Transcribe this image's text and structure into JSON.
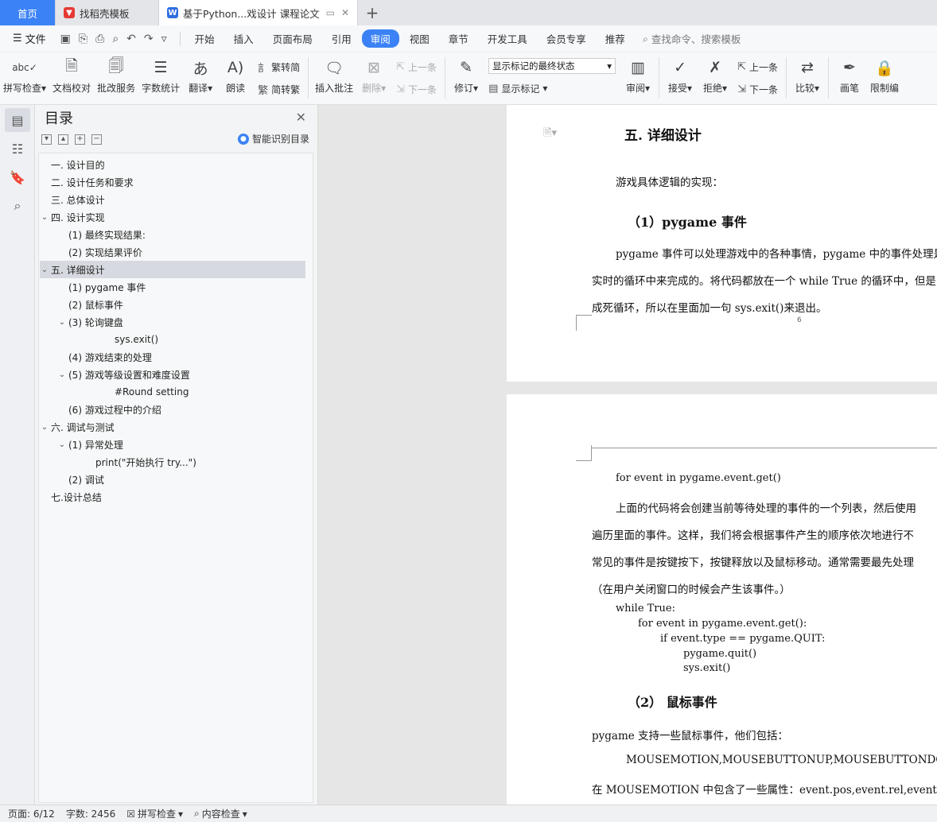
{
  "tabs": {
    "home": "首页",
    "template": "找稻壳模板",
    "doc": "基于Python...戏设计 课程论文"
  },
  "menu": {
    "file": "文件",
    "items": [
      "开始",
      "插入",
      "页面布局",
      "引用",
      "审阅",
      "视图",
      "章节",
      "开发工具",
      "会员专享",
      "推荐"
    ],
    "active": "审阅",
    "search": "查找命令、搜索模板"
  },
  "ribbon": {
    "spell": "拼写检查",
    "proof": "文档校对",
    "batch": "批改服务",
    "wordcount": "字数统计",
    "translate": "翻译",
    "read": "朗读",
    "to_simplified": "繁转简",
    "to_traditional": "简转繁",
    "insert_comment": "插入批注",
    "delete": "删除",
    "prev": "上一条",
    "next": "下一条",
    "revise": "修订",
    "markup_select": "显示标记的最终状态",
    "show_markup": "显示标记",
    "review": "审阅",
    "accept": "接受",
    "reject": "拒绝",
    "prev2": "上一条",
    "next2": "下一条",
    "compare": "比较",
    "pen": "画笔",
    "restrict": "限制编"
  },
  "toc": {
    "title": "目录",
    "smart": "智能识别目录",
    "items": [
      {
        "label": "一. 设计目的",
        "level": 1,
        "arrow": ""
      },
      {
        "label": "二. 设计任务和要求",
        "level": 1,
        "arrow": ""
      },
      {
        "label": "三. 总体设计",
        "level": 1,
        "arrow": ""
      },
      {
        "label": "四. 设计实现",
        "level": 1,
        "arrow": "v"
      },
      {
        "label": "(1) 最终实现结果:",
        "level": 2,
        "arrow": ""
      },
      {
        "label": "(2) 实现结果评价",
        "level": 2,
        "arrow": ""
      },
      {
        "label": "五. 详细设计",
        "level": 1,
        "arrow": "v",
        "selected": true
      },
      {
        "label": "(1) pygame 事件",
        "level": 2,
        "arrow": ""
      },
      {
        "label": "(2)  鼠标事件",
        "level": 2,
        "arrow": ""
      },
      {
        "label": "(3) 轮询键盘",
        "level": 2,
        "arrow": "v"
      },
      {
        "label": "sys.exit()",
        "level": 4,
        "arrow": ""
      },
      {
        "label": "(4) 游戏结束的处理",
        "level": 2,
        "arrow": ""
      },
      {
        "label": "(5) 游戏等级设置和难度设置",
        "level": 2,
        "arrow": "v"
      },
      {
        "label": "#Round setting",
        "level": 4,
        "arrow": ""
      },
      {
        "label": "(6) 游戏过程中的介绍",
        "level": 2,
        "arrow": ""
      },
      {
        "label": "六. 调试与测试",
        "level": 1,
        "arrow": "v"
      },
      {
        "label": "(1) 异常处理",
        "level": 2,
        "arrow": "v"
      },
      {
        "label": "print(\"开始执行 try...\")",
        "level": 3,
        "arrow": ""
      },
      {
        "label": "(2) 调试",
        "level": 2,
        "arrow": ""
      },
      {
        "label": "七.设计总结",
        "level": 1,
        "arrow": ""
      }
    ]
  },
  "page1": {
    "heading": "五. 详细设计",
    "intro": "游戏具体逻辑的实现：",
    "subheading": "（1）pygame 事件",
    "lines": [
      "pygame 事件可以处理游戏中的各种事情，pygame 中的事件处理是",
      "实时的循环中来完成的。将代码都放在一个 while True 的循环中，但是",
      "成死循环，所以在里面加一句 sys.exit()来退出。"
    ],
    "page_number": "6"
  },
  "page2": {
    "code1": "for event in pygame.event.get()",
    "lines": [
      "上面的代码将会创建当前等待处理的事件的一个列表，然后使用",
      "遍历里面的事件。这样，我们将会根据事件产生的顺序依次地进行不",
      "常见的事件是按键按下，按键释放以及鼠标移动。通常需要最先处理",
      "（在用户关闭窗口的时候会产生该事件。）"
    ],
    "code": [
      "while True:",
      "for event in pygame.event.get():",
      "if event.type == pygame.QUIT:",
      "pygame.quit()",
      "sys.exit()"
    ],
    "subheading": "（2） 鼠标事件",
    "p1": "pygame 支持一些鼠标事件，他们包括：",
    "p2": "MOUSEMOTION,MOUSEBUTTONUP,MOUSEBUTTONDOWN",
    "p3": "在 MOUSEMOTION 中包含了一些属性：event.pos,event.rel,event.butto"
  },
  "status": {
    "page": "页面: 6/12",
    "words": "字数: 2456",
    "spell": "拼写检查",
    "content": "内容检查"
  }
}
